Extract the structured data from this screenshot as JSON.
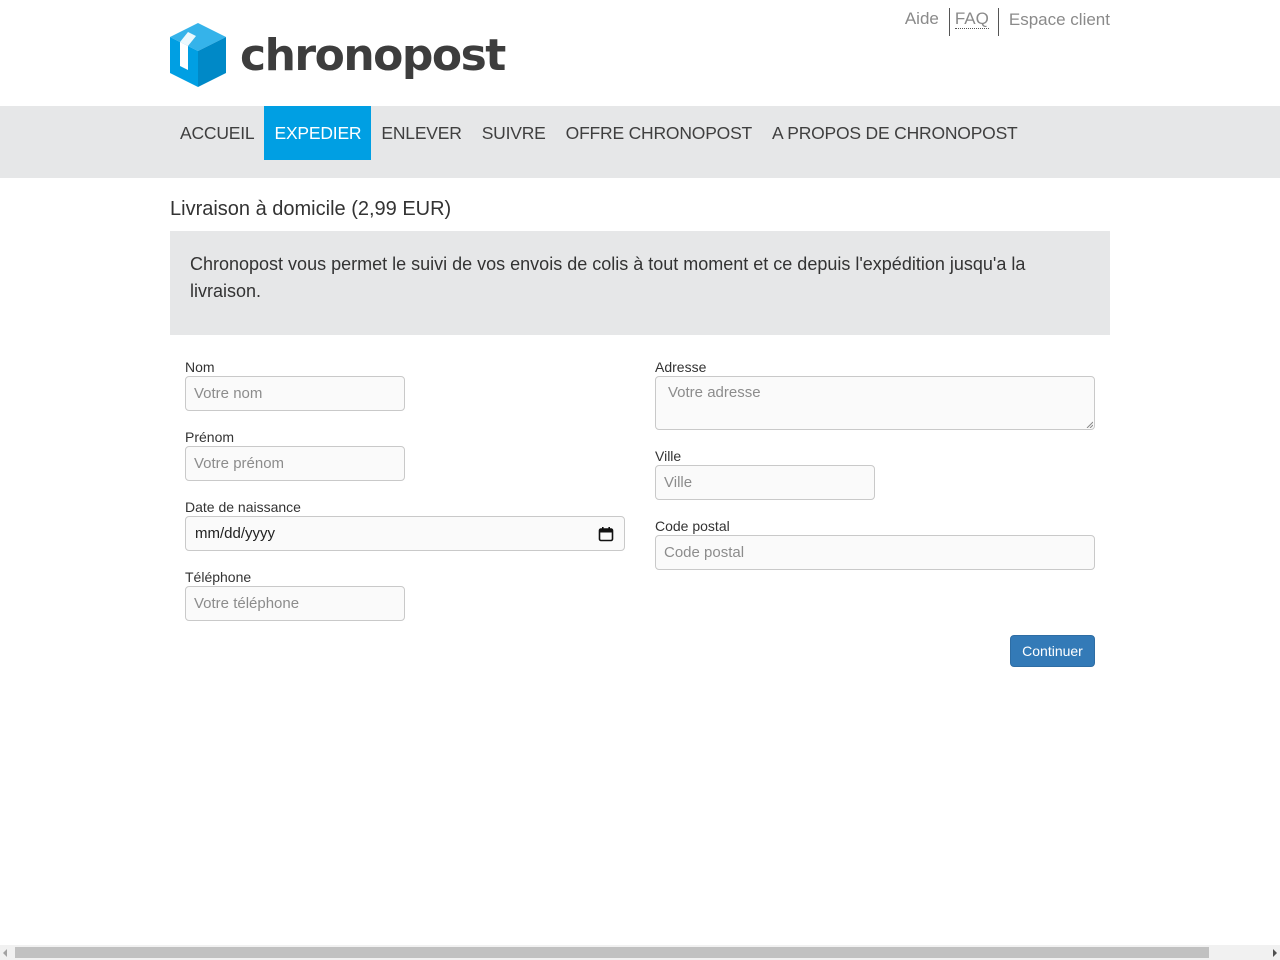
{
  "brand": {
    "name": "chronopost",
    "color": "#009fe3",
    "icon": "parcel-box-logo"
  },
  "top_links": {
    "aide": "Aide",
    "faq": "FAQ",
    "espace_client": "Espace client"
  },
  "nav": {
    "items": [
      {
        "label": "ACCUEIL"
      },
      {
        "label": "EXPEDIER",
        "active": true
      },
      {
        "label": "ENLEVER"
      },
      {
        "label": "SUIVRE"
      },
      {
        "label": "OFFRE CHRONOPOST"
      },
      {
        "label": "A PROPOS DE CHRONOPOST"
      }
    ],
    "active_color": "#009fe3"
  },
  "page": {
    "title": "Livraison à domicile (2,99 EUR)",
    "info": "Chronopost vous permet le suivi de vos envois de colis à tout moment et ce depuis l'expédition jusqu'a la livraison."
  },
  "form": {
    "nom": {
      "label": "Nom",
      "placeholder": "Votre nom"
    },
    "prenom": {
      "label": "Prénom",
      "placeholder": "Votre prénom"
    },
    "date_naissance": {
      "label": "Date de naissance",
      "placeholder": "mm/dd/yyyy",
      "icon": "calendar-icon"
    },
    "telephone": {
      "label": "Téléphone",
      "placeholder": "Votre téléphone"
    },
    "adresse": {
      "label": "Adresse",
      "placeholder": "Votre adresse"
    },
    "ville": {
      "label": "Ville",
      "placeholder": "Ville"
    },
    "code_postal": {
      "label": "Code postal",
      "placeholder": "Code postal"
    },
    "submit_label": "Continuer",
    "submit_color": "#337ab7"
  }
}
